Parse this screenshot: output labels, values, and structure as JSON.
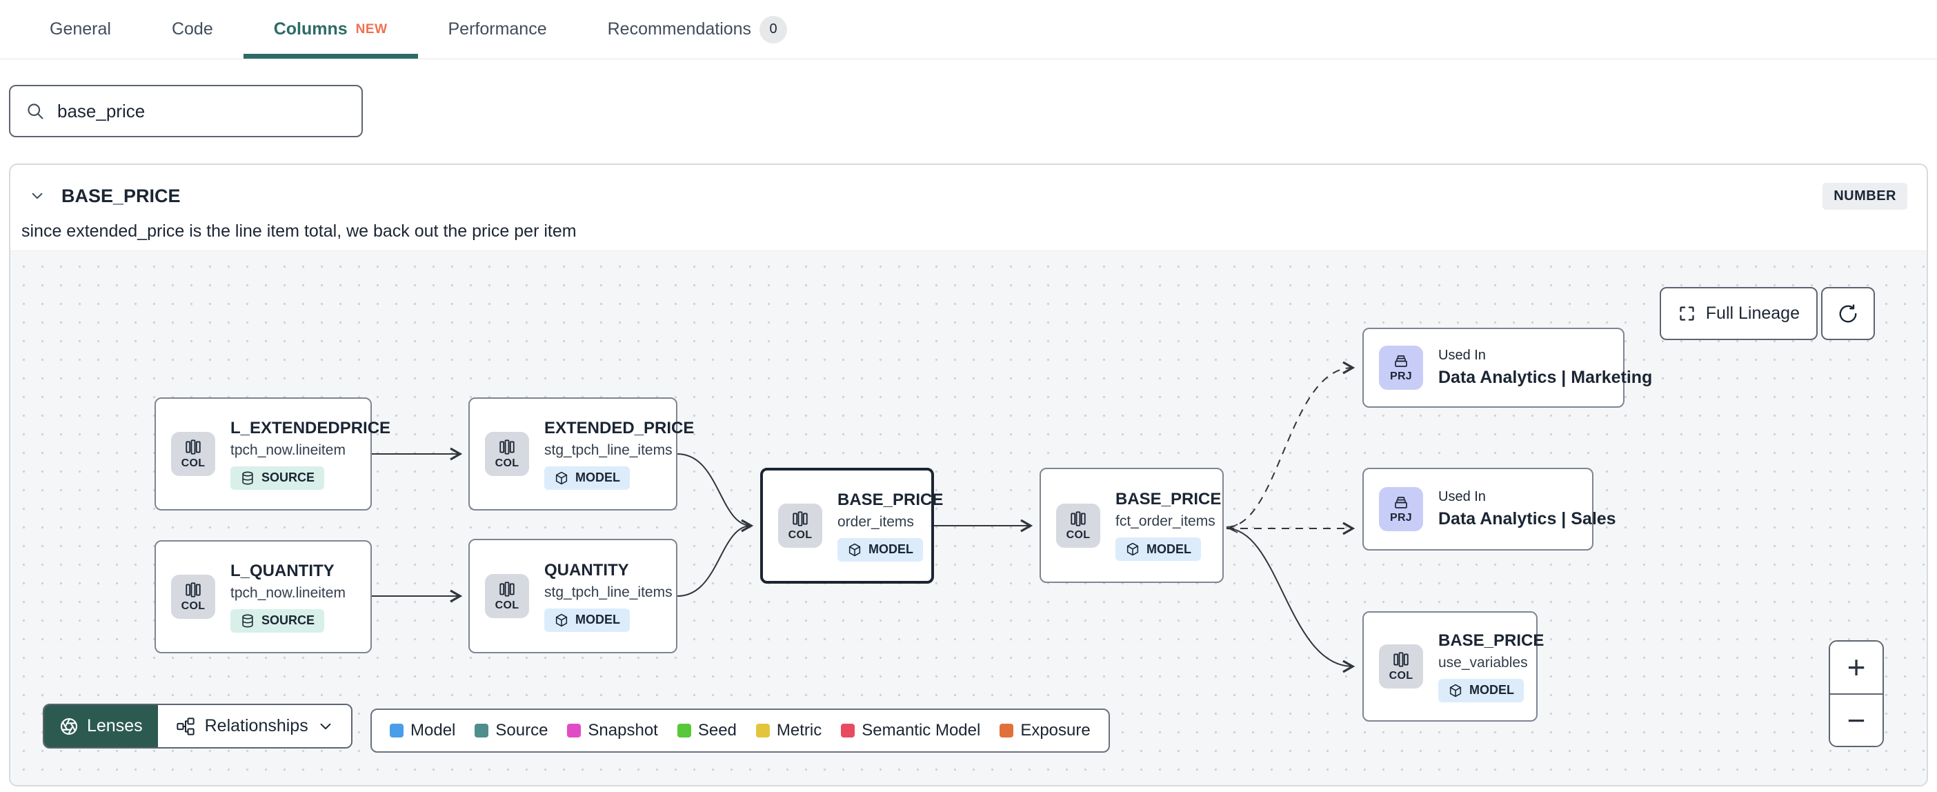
{
  "tab_bar": {
    "tabs": [
      {
        "label": "General"
      },
      {
        "label": "Code"
      },
      {
        "label": "Columns",
        "badge": "NEW"
      },
      {
        "label": "Performance"
      },
      {
        "label": "Recommendations",
        "count": "0"
      }
    ]
  },
  "search": {
    "value": "base_price"
  },
  "column_panel": {
    "name": "BASE_PRICE",
    "data_type": "NUMBER",
    "description": "since extended_price is the line item total, we back out the price per item"
  },
  "lineage": {
    "buttons": {
      "full_lineage": "Full Lineage",
      "lenses": "Lenses",
      "relationships": "Relationships",
      "zoom_in": "+",
      "zoom_out": "−"
    },
    "nodes": [
      {
        "kind": "COL",
        "title": "L_EXTENDEDPRICE",
        "subtitle": "tpch_now.lineitem",
        "resource": "SOURCE"
      },
      {
        "kind": "COL",
        "title": "L_QUANTITY",
        "subtitle": "tpch_now.lineitem",
        "resource": "SOURCE"
      },
      {
        "kind": "COL",
        "title": "EXTENDED_PRICE",
        "subtitle": "stg_tpch_line_items",
        "resource": "MODEL"
      },
      {
        "kind": "COL",
        "title": "QUANTITY",
        "subtitle": "stg_tpch_line_items",
        "resource": "MODEL"
      },
      {
        "kind": "COL",
        "title": "BASE_PRICE",
        "subtitle": "order_items",
        "resource": "MODEL"
      },
      {
        "kind": "COL",
        "title": "BASE_PRICE",
        "subtitle": "fct_order_items",
        "resource": "MODEL"
      },
      {
        "kind": "PRJ",
        "label": "Used In",
        "title": "Data Analytics | Marketing"
      },
      {
        "kind": "PRJ",
        "label": "Used In",
        "title": "Data Analytics | Sales"
      },
      {
        "kind": "COL",
        "title": "BASE_PRICE",
        "subtitle": "use_variables",
        "resource": "MODEL"
      }
    ],
    "legend": [
      {
        "label": "Model",
        "color": "#4a9de9"
      },
      {
        "label": "Source",
        "color": "#4f8e8d"
      },
      {
        "label": "Snapshot",
        "color": "#e14cc6"
      },
      {
        "label": "Seed",
        "color": "#57c839"
      },
      {
        "label": "Metric",
        "color": "#e2c53d"
      },
      {
        "label": "Semantic Model",
        "color": "#e84a5f"
      },
      {
        "label": "Exposure",
        "color": "#e1703a"
      }
    ]
  }
}
